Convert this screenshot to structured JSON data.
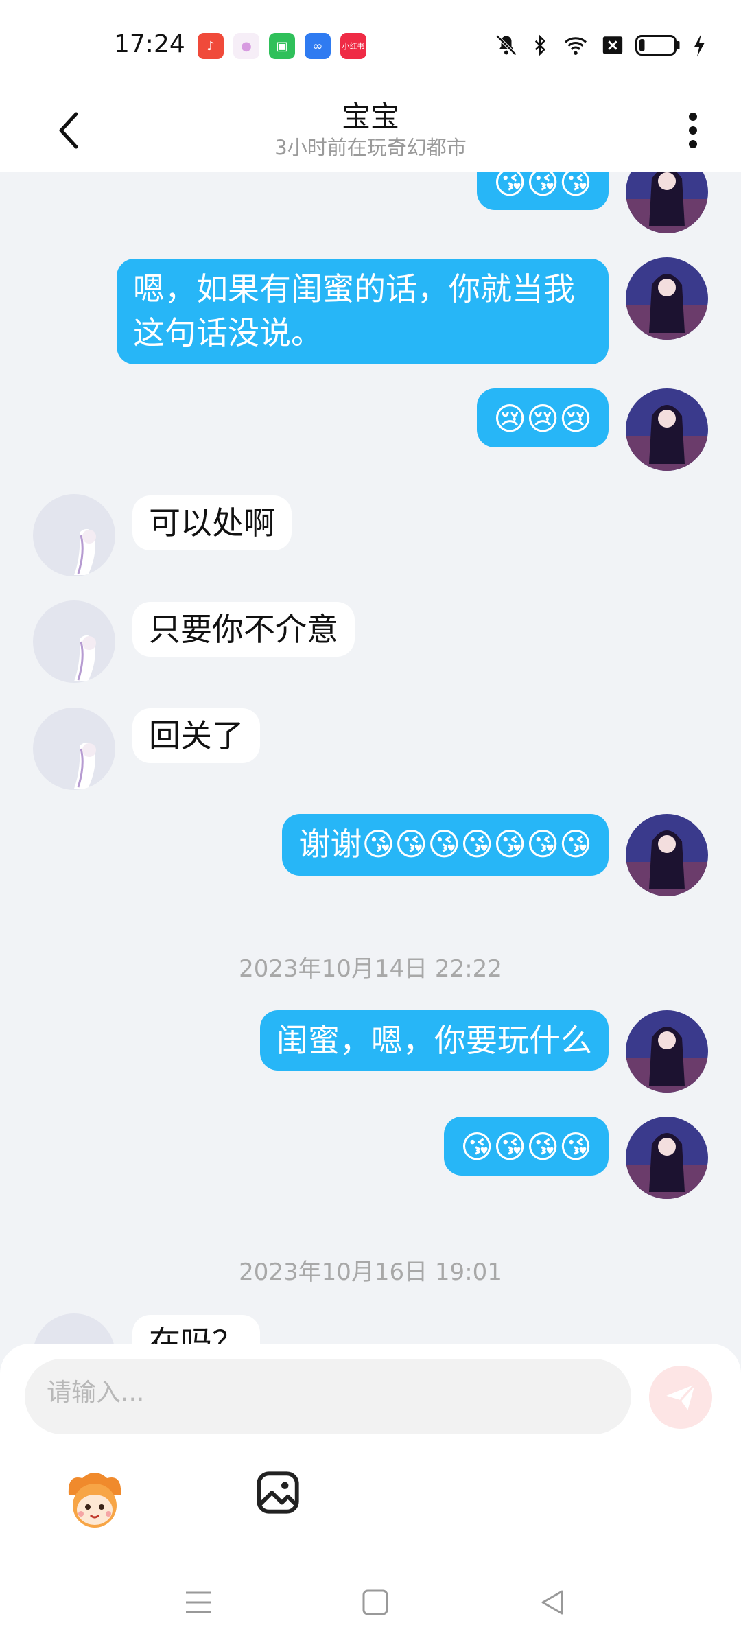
{
  "status_bar": {
    "time": "17:24",
    "app_icons": [
      {
        "name": "music-app-icon",
        "color": "#f04a3a",
        "glyph": "♪"
      },
      {
        "name": "light-app-icon",
        "color": "#f3d9f5",
        "glyph": "●"
      },
      {
        "name": "store-app-icon",
        "color": "#2fc05a",
        "glyph": "◧"
      },
      {
        "name": "infinity-app-icon",
        "color": "#2f7bf1",
        "glyph": "∞"
      },
      {
        "name": "xiaohongshu-app-icon",
        "color": "#ef2b45",
        "glyph": "小红书"
      }
    ],
    "battery_level": 0.12
  },
  "header": {
    "title": "宝宝",
    "subtitle": "3小时前在玩奇幻都市"
  },
  "messages": [
    {
      "dir": "out",
      "text": "😘😘😘"
    },
    {
      "dir": "out",
      "text": "嗯，如果有闺蜜的话，你就当我这句话没说。"
    },
    {
      "dir": "out",
      "text": "😢😢😢"
    },
    {
      "dir": "in",
      "text": "可以处啊"
    },
    {
      "dir": "in",
      "text": "只要你不介意"
    },
    {
      "dir": "in",
      "text": "回关了"
    },
    {
      "dir": "out",
      "text": "谢谢😘😘😘😘😘😘😘"
    },
    {
      "dir": "time",
      "text": "2023年10月14日 22:22"
    },
    {
      "dir": "out",
      "text": "闺蜜，嗯，你要玩什么"
    },
    {
      "dir": "out",
      "text": "😘😘😘😘"
    },
    {
      "dir": "time",
      "text": "2023年10月16日 19:01"
    },
    {
      "dir": "in",
      "text": "在吗？"
    }
  ],
  "composer": {
    "placeholder": "请输入..."
  },
  "colors": {
    "accent": "#27b6f7",
    "send_disabled": "#fde5e5"
  }
}
